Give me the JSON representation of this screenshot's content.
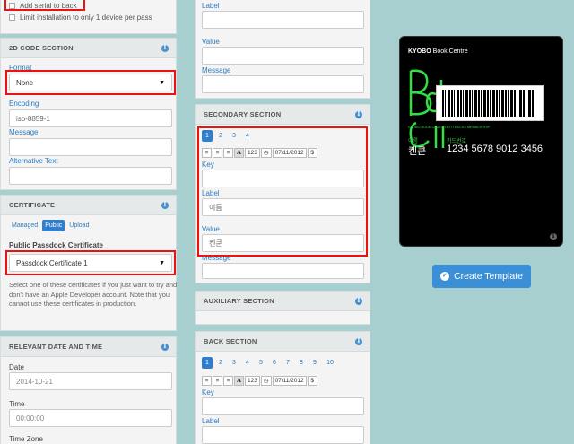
{
  "left": {
    "checkbox_serial": "Add serial to back",
    "checkbox_limit": "Limit installation to only 1 device per pass",
    "code_section": {
      "title": "2D CODE SECTION",
      "format_label": "Format",
      "format_value": "None",
      "encoding_label": "Encoding",
      "encoding_value": "iso-8859-1",
      "message_label": "Message",
      "alt_text_label": "Alternative Text"
    },
    "certificate": {
      "title": "CERTIFICATE",
      "tabs": [
        "Managed",
        "Public",
        "Upload"
      ],
      "active_tab": "Public",
      "public_label": "Public Passdock Certificate",
      "select_value": "Passdock Certificate 1",
      "help": "Select one of these certificates if you just want to try and don't have an Apple Developer account. Note that you cannot use these certificates in production."
    },
    "relevant": {
      "title": "RELEVANT DATE AND TIME",
      "date_label": "Date",
      "date_value": "2014-10-21",
      "time_label": "Time",
      "time_value": "00:00:00",
      "tz_label": "Time Zone"
    }
  },
  "middle": {
    "top": {
      "label": "Label",
      "value": "Value",
      "message": "Message"
    },
    "secondary": {
      "title": "SECONDARY SECTION",
      "pages": [
        "1",
        "2",
        "3",
        "4"
      ],
      "toolbar": {
        "a": "A",
        "num": "123",
        "date": "07/11/2012",
        "currency": "$"
      },
      "key_label": "Key",
      "label_label": "Label",
      "label_value": "이름",
      "value_label": "Value",
      "value_value": "켄쿤",
      "message_label": "Message"
    },
    "auxiliary": {
      "title": "AUXILIARY SECTION"
    },
    "back": {
      "title": "BACK SECTION",
      "pages": [
        "1",
        "2",
        "3",
        "4",
        "5",
        "6",
        "7",
        "8",
        "9",
        "10"
      ],
      "toolbar": {
        "a": "A",
        "num": "123",
        "date": "07/11/2012",
        "currency": "$"
      },
      "key_label": "Key",
      "label_label": "Label"
    }
  },
  "preview": {
    "logo": "KYOBO",
    "logo_suffix": "Book Centre",
    "membership": "KYOBO BOOK CLUB & HOTTRACKS MEMBERSHIP",
    "name_label": "이름",
    "name_value": "켄쿤",
    "card_label": "카드번호",
    "card_value": "1234 5678 9012 3456",
    "button": "Create Template"
  },
  "colors": {
    "background": "#a7cfcf",
    "accent": "#2f7fce",
    "highlight": "#e11111"
  }
}
